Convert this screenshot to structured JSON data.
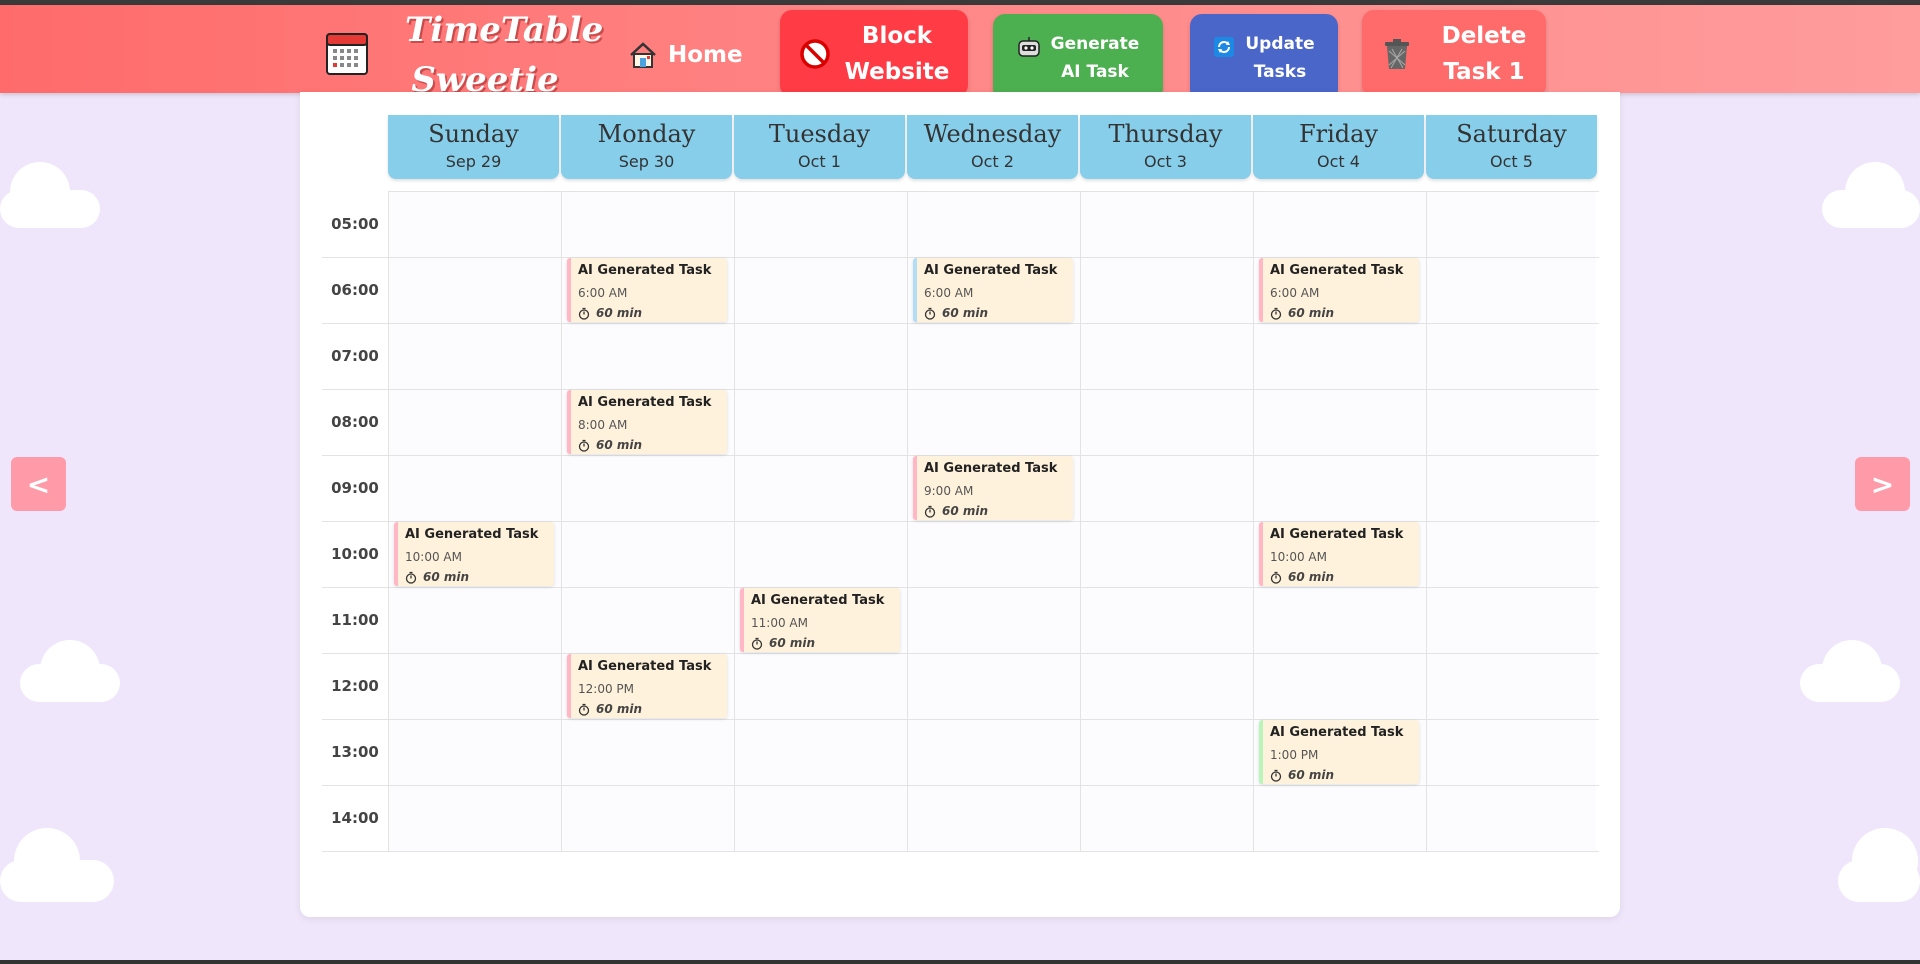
{
  "navbar": {
    "brand_line1": "TimeTable",
    "brand_line2": "Sweetie",
    "home_label": "Home",
    "block_line1": "Block",
    "block_line2": "Website",
    "generate_line1": "Generate",
    "generate_line2": "AI Task",
    "update_line1": "Update",
    "update_line2": "Tasks",
    "delete_line1": "Delete",
    "delete_line2": "Task 1",
    "icons": [
      "calendar-icon",
      "home-icon",
      "block-icon",
      "robot-icon",
      "refresh-icon",
      "trash-icon"
    ]
  },
  "calendar": {
    "days": [
      {
        "name": "Sunday",
        "date": "Sep 29"
      },
      {
        "name": "Monday",
        "date": "Sep 30"
      },
      {
        "name": "Tuesday",
        "date": "Oct 1"
      },
      {
        "name": "Wednesday",
        "date": "Oct 2"
      },
      {
        "name": "Thursday",
        "date": "Oct 3"
      },
      {
        "name": "Friday",
        "date": "Oct 4"
      },
      {
        "name": "Saturday",
        "date": "Oct 5"
      }
    ],
    "hours": [
      "05:00",
      "06:00",
      "07:00",
      "08:00",
      "09:00",
      "10:00",
      "11:00",
      "12:00",
      "13:00",
      "14:00"
    ],
    "tasks": [
      {
        "title": "AI Generated Task",
        "day": "Monday",
        "hour": "06:00",
        "time": "6:00 AM",
        "duration": "60 min",
        "accent": "#ffb7c5"
      },
      {
        "title": "AI Generated Task",
        "day": "Wednesday",
        "hour": "06:00",
        "time": "6:00 AM",
        "duration": "60 min",
        "accent": "#b3dcf5"
      },
      {
        "title": "AI Generated Task",
        "day": "Friday",
        "hour": "06:00",
        "time": "6:00 AM",
        "duration": "60 min",
        "accent": "#ffb7c5"
      },
      {
        "title": "AI Generated Task",
        "day": "Monday",
        "hour": "08:00",
        "time": "8:00 AM",
        "duration": "60 min",
        "accent": "#ffb7c5"
      },
      {
        "title": "AI Generated Task",
        "day": "Wednesday",
        "hour": "09:00",
        "time": "9:00 AM",
        "duration": "60 min",
        "accent": "#ffb7c5"
      },
      {
        "title": "AI Generated Task",
        "day": "Sunday",
        "hour": "10:00",
        "time": "10:00 AM",
        "duration": "60 min",
        "accent": "#ffb7c5"
      },
      {
        "title": "AI Generated Task",
        "day": "Friday",
        "hour": "10:00",
        "time": "10:00 AM",
        "duration": "60 min",
        "accent": "#ffb7c5"
      },
      {
        "title": "AI Generated Task",
        "day": "Tuesday",
        "hour": "11:00",
        "time": "11:00 AM",
        "duration": "60 min",
        "accent": "#ffb7c5"
      },
      {
        "title": "AI Generated Task",
        "day": "Monday",
        "hour": "12:00",
        "time": "12:00 PM",
        "duration": "60 min",
        "accent": "#ffb7c5"
      },
      {
        "title": "AI Generated Task",
        "day": "Friday",
        "hour": "13:00",
        "time": "1:00 PM",
        "duration": "60 min",
        "accent": "#b9f5b9"
      }
    ]
  },
  "nav_arrows": {
    "prev": "<",
    "next": ">"
  },
  "colors": {
    "navbar": "#ff6b6b",
    "day_header": "#87ceeb",
    "task_bg": "#fff2dc",
    "page_bg": "#f0e6fb"
  }
}
